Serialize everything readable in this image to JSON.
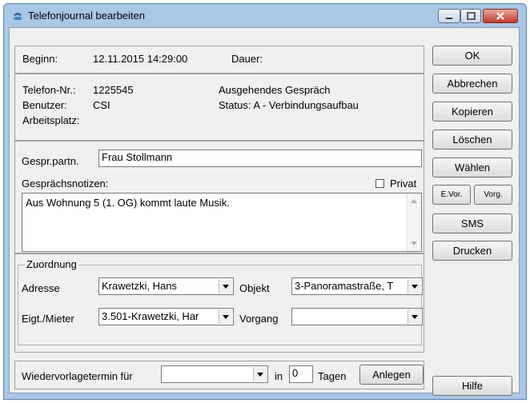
{
  "window": {
    "title": "Telefonjournal bearbeiten"
  },
  "header": {
    "beginn_label": "Beginn:",
    "beginn_value": "12.11.2015 14:29:00",
    "dauer_label": "Dauer:"
  },
  "info": {
    "telefon_label": "Telefon-Nr.:",
    "telefon_value": "1225545",
    "benutzer_label": "Benutzer:",
    "benutzer_value": "CSI",
    "arbeitsplatz_label": "Arbeitsplatz:",
    "richtung": "Ausgehendes Gespräch",
    "status": "Status: A - Verbindungsaufbau"
  },
  "gespraech": {
    "partner_label": "Gespr.partn.",
    "partner_value": "Frau Stollmann",
    "notizen_label": "Gesprächsnotizen:",
    "privat_label": "Privat",
    "notizen_value": "Aus Wohnung 5 (1. OG) kommt laute Musik."
  },
  "zuordnung": {
    "legend": "Zuordnung",
    "adresse_label": "Adresse",
    "adresse_value": "Krawetzki, Hans",
    "objekt_label": "Objekt",
    "objekt_value": "3-Panoramastraße, T",
    "eigt_label": "Eigt./Mieter",
    "eigt_value": "3.501-Krawetzki, Har",
    "vorgang_label": "Vorgang",
    "vorgang_value": ""
  },
  "wiedervorlage": {
    "label": "Wiedervorlagetermin für",
    "select_value": "",
    "in_label": "in",
    "tage_value": "0",
    "tage_label": "Tagen",
    "anlegen_label": "Anlegen"
  },
  "buttons": {
    "ok": "OK",
    "abbrechen": "Abbrechen",
    "kopieren": "Kopieren",
    "loeschen": "Löschen",
    "waehlen": "Wählen",
    "evor": "E.Vor.",
    "vorg": "Vorg.",
    "sms": "SMS",
    "drucken": "Drucken",
    "hilfe": "Hilfe"
  }
}
